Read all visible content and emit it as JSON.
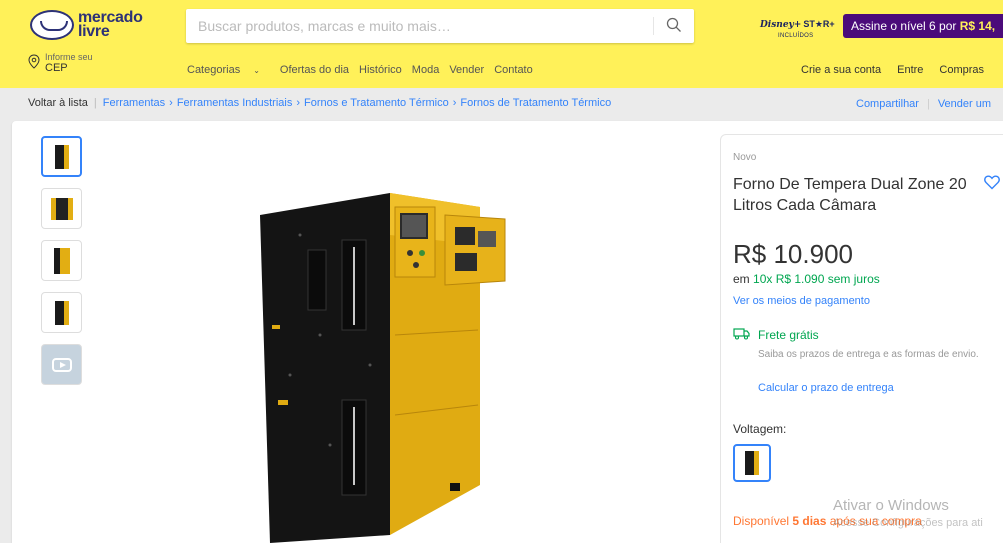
{
  "header": {
    "logo_line1": "mercado",
    "logo_line2": "livre",
    "search_placeholder": "Buscar produtos, marcas e muito mais…",
    "disney_logo": "Disney+",
    "disney_star": "ST★R+",
    "disney_incl": "INCLUÍDOS",
    "promo_text": "Assine o nível 6 por",
    "promo_price": "R$ 14,",
    "cep_small": "Informe seu",
    "cep_big": "CEP",
    "nav": [
      "Categorias",
      "Ofertas do dia",
      "Histórico",
      "Moda",
      "Vender",
      "Contato"
    ],
    "account": [
      "Crie a sua conta",
      "Entre",
      "Compras"
    ]
  },
  "breadcrumb": {
    "back": "Voltar à lista",
    "items": [
      "Ferramentas",
      "Ferramentas Industriais",
      "Fornos e Tratamento Térmico",
      "Fornos de Tratamento Térmico"
    ],
    "share": "Compartilhar",
    "sell": "Vender um"
  },
  "product": {
    "condition": "Novo",
    "title": "Forno De Tempera Dual Zone 20 Litros Cada Câmara",
    "price": "R$ 10.900",
    "installments_prefix": "em",
    "installments_green": "10x R$ 1.090 sem juros",
    "payment_link": "Ver os meios de pagamento",
    "shipping_title": "Frete grátis",
    "shipping_desc": "Saiba os prazos de entrega e as formas de envio.",
    "shipping_link": "Calcular o prazo de entrega",
    "voltage_label": "Voltagem:",
    "stock_text_a": "Disponível",
    "stock_text_b": "5 dias",
    "stock_text_c": "após sua compra"
  },
  "watermark": {
    "line1": "Ativar o Windows",
    "line2": "Acesse Configurações para ati"
  },
  "colors": {
    "header_bg": "#fff159",
    "link": "#3483fa",
    "green": "#00a650",
    "orange": "#ff7733",
    "promo_bg": "#4b0b7a"
  }
}
